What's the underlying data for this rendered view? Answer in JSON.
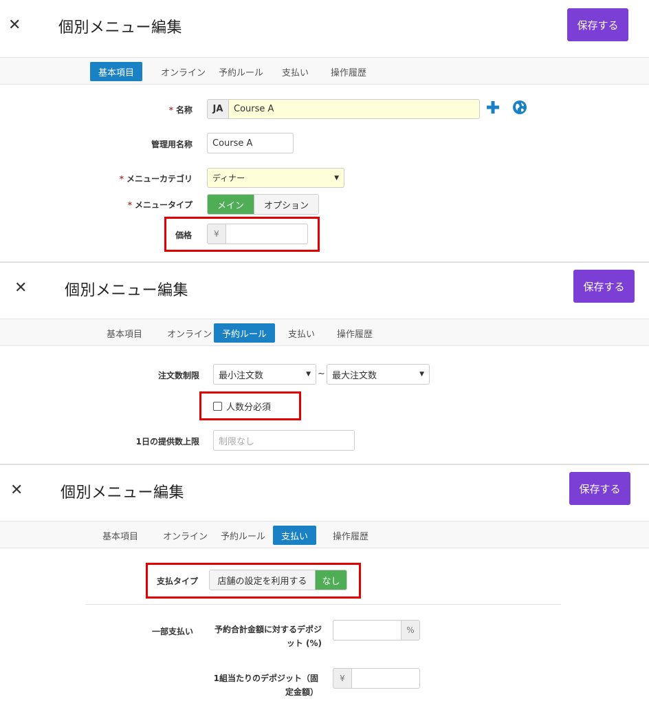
{
  "title": "個別メニュー編集",
  "close_glyph": "✕",
  "save_label": "保存する",
  "tabs": [
    "基本項目",
    "オンライン",
    "予約ルール",
    "支払い",
    "操作履歴"
  ],
  "colors": {
    "accent_purple": "#7b3fd6",
    "tab_active": "#1a82c4",
    "toggle_on": "#4fae55",
    "highlight_red": "#e00000",
    "required_input": "#fefed8"
  },
  "panel1": {
    "active_tab": "基本項目",
    "name": {
      "label": "名称",
      "lang": "JA",
      "value": "Course A",
      "add_icon": "plus-icon",
      "globe_icon": "globe-icon"
    },
    "admin_name": {
      "label": "管理用名称",
      "value": "Course A"
    },
    "category": {
      "label": "メニューカテゴリ",
      "value": "ディナー"
    },
    "menu_type": {
      "label": "メニュータイプ",
      "options": [
        "メイン",
        "オプション"
      ],
      "selected": "メイン"
    },
    "price": {
      "label": "価格",
      "currency": "¥",
      "value": ""
    }
  },
  "panel2": {
    "active_tab": "予約ルール",
    "order_limit": {
      "label": "注文数制限",
      "min_value": "最小注文数",
      "separator": "~",
      "max_value": "最大注文数"
    },
    "per_person": {
      "label": "人数分必須",
      "checked": false
    },
    "daily_limit": {
      "label": "1日の提供数上限",
      "placeholder": "制限なし"
    }
  },
  "panel3": {
    "active_tab": "支払い",
    "payment_type": {
      "label": "支払タイプ",
      "options": [
        "店舗の設定を利用する",
        "なし"
      ],
      "selected": "なし"
    },
    "partial": {
      "label": "一部支払い",
      "deposit_pct": {
        "label": "予約合計金額に対するデポジット (%)",
        "unit": "%",
        "value": ""
      },
      "deposit_fixed": {
        "label": "1組当たりのデポジット（固定金額）",
        "currency": "¥",
        "value": ""
      }
    }
  }
}
